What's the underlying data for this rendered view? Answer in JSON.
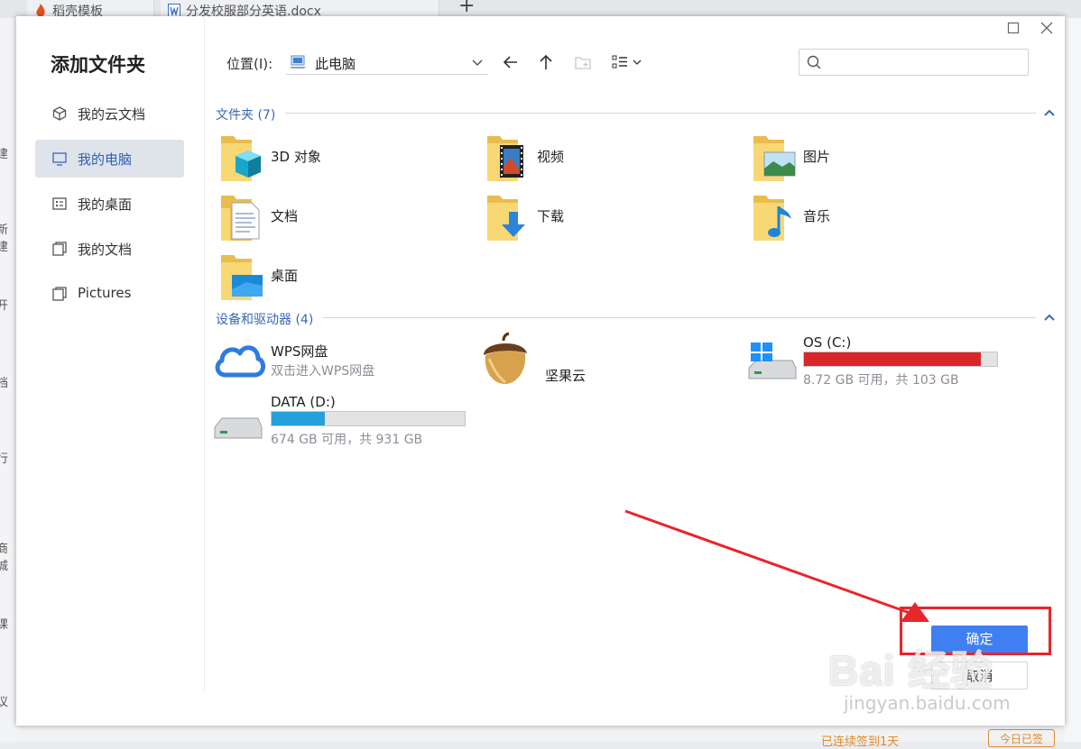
{
  "background": {
    "tabs": [
      {
        "label": "稻壳模板"
      },
      {
        "label": "分发校服部分英语.docx"
      }
    ],
    "left_fragments": [
      "建",
      "新建",
      "开",
      "档",
      "行",
      "商城",
      "课",
      "议"
    ],
    "signin_text": "已连续签到1天",
    "today_button": "今日已签"
  },
  "dialog": {
    "title": "添加文件夹",
    "sidebar": [
      {
        "label": "我的云文档",
        "icon": "cloud-doc-icon",
        "active": false
      },
      {
        "label": "我的电脑",
        "icon": "monitor-icon",
        "active": true
      },
      {
        "label": "我的桌面",
        "icon": "desktop-icon",
        "active": false
      },
      {
        "label": "我的文档",
        "icon": "documents-icon",
        "active": false
      },
      {
        "label": "Pictures",
        "icon": "folder-icon",
        "active": false
      }
    ],
    "location": {
      "label": "位置(I):",
      "value": "此电脑"
    },
    "folders_section": {
      "title": "文件夹 (7)",
      "items": [
        {
          "name": "3D 对象",
          "icon": "3d-objects-folder-icon"
        },
        {
          "name": "视频",
          "icon": "videos-folder-icon"
        },
        {
          "name": "图片",
          "icon": "pictures-folder-icon"
        },
        {
          "name": "文档",
          "icon": "documents-folder-icon"
        },
        {
          "name": "下载",
          "icon": "downloads-folder-icon"
        },
        {
          "name": "音乐",
          "icon": "music-folder-icon"
        },
        {
          "name": "桌面",
          "icon": "desktop-folder-icon"
        }
      ]
    },
    "devices_section": {
      "title": "设备和驱动器 (4)",
      "items": [
        {
          "name": "WPS网盘",
          "sub": "双击进入WPS网盘",
          "icon": "wps-cloud-icon"
        },
        {
          "name": "坚果云",
          "icon": "nutstore-acorn-icon"
        },
        {
          "name": "OS (C:)",
          "sub": "8.72 GB 可用，共 103 GB",
          "icon": "windows-drive-icon",
          "used_fraction": 0.915,
          "bar_color": "#d9262a"
        },
        {
          "name": "DATA (D:)",
          "sub": "674 GB 可用，共 931 GB",
          "icon": "drive-icon",
          "used_fraction": 0.276,
          "bar_color": "#26a0da"
        }
      ]
    },
    "buttons": {
      "ok": "确定",
      "cancel": "取消"
    }
  },
  "watermark": {
    "main": "Bai 经验",
    "sub": "jingyan.baidu.com"
  },
  "colors": {
    "accent": "#3f7ff1",
    "annotation": "#e8262b",
    "section": "#3b67b8"
  }
}
